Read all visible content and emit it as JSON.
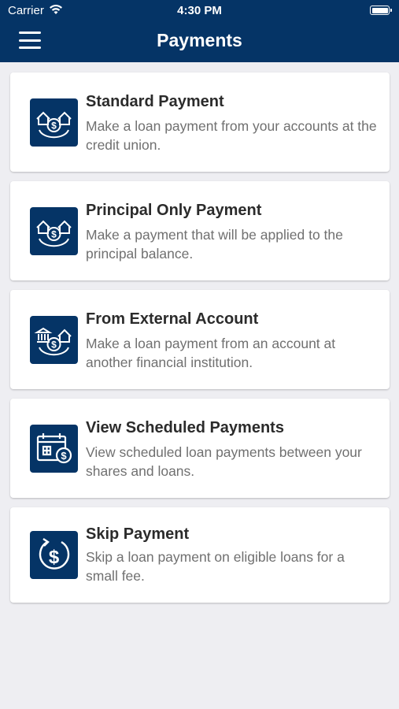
{
  "status_bar": {
    "carrier": "Carrier",
    "time": "4:30 PM"
  },
  "header": {
    "title": "Payments",
    "menu_icon": "hamburger-menu-icon"
  },
  "colors": {
    "brand": "#053466",
    "background": "#eeeef2",
    "card": "#ffffff",
    "title_text": "#2b2b2b",
    "desc_text": "#707070"
  },
  "options": [
    {
      "title": "Standard Payment",
      "description": "Make a loan payment from your accounts at the credit union.",
      "icon": "house-dollar-icon"
    },
    {
      "title": "Principal Only Payment",
      "description": "Make a payment that will be applied to the principal balance.",
      "icon": "house-dollar-icon"
    },
    {
      "title": "From External Account",
      "description": "Make a loan payment from an account at another financial institution.",
      "icon": "bank-house-dollar-icon"
    },
    {
      "title": "View Scheduled Payments",
      "description": "View scheduled loan payments between your shares and loans.",
      "icon": "calendar-dollar-icon"
    },
    {
      "title": "Skip Payment",
      "description": "Skip a loan payment on eligible loans for a small fee.",
      "icon": "cycle-dollar-icon"
    }
  ]
}
